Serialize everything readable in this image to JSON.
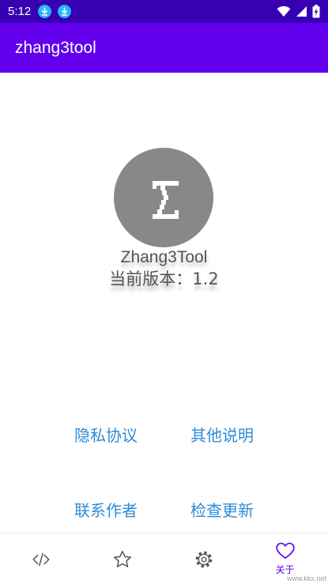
{
  "status_bar": {
    "time": "5:12",
    "background": "#3700b3",
    "icons": [
      "download-icon",
      "download-icon",
      "wifi-icon",
      "signal-icon",
      "battery-charging-icon"
    ]
  },
  "app_bar": {
    "title": "zhang3tool",
    "background": "#6200ee"
  },
  "about": {
    "logo_icon": "z-logo-icon",
    "app_name": "Zhang3Tool",
    "version_label": "当前版本：",
    "version": "1.2"
  },
  "links": {
    "privacy": "隐私协议",
    "other_notes": "其他说明",
    "contact_author": "联系作者",
    "check_update": "检查更新",
    "color": "#2e8bd8"
  },
  "bottom_nav": {
    "items": [
      {
        "icon": "code-icon",
        "label": ""
      },
      {
        "icon": "star-icon",
        "label": ""
      },
      {
        "icon": "gear-icon",
        "label": ""
      },
      {
        "icon": "heart-icon",
        "label": "关于"
      }
    ],
    "active_index": 3,
    "active_color": "#6200ee"
  },
  "watermark": "www.kkx.net"
}
